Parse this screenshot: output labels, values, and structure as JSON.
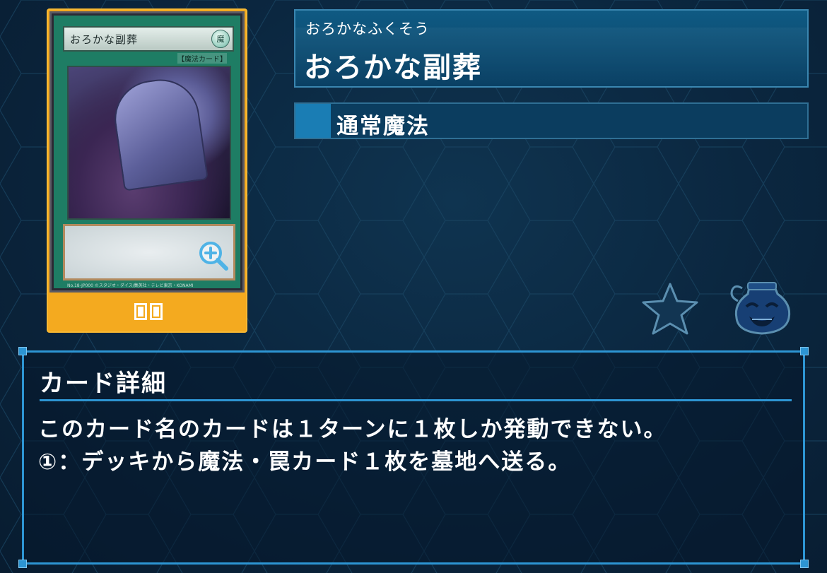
{
  "card": {
    "name_on_card": "おろかな副葬",
    "attribute_glyph": "魔",
    "type_line": "【魔法カード】",
    "footer": "No.18-JP000 ©スタジオ・ダイス/集英社・テレビ東京・KONAMI",
    "bottom_icon": "card-pair-icon"
  },
  "info": {
    "ruby": "おろかなふくそう",
    "title": "おろかな副葬",
    "type": "通常魔法",
    "type_color": "#1a7db4"
  },
  "buttons": {
    "favorite_icon": "star-icon",
    "pot_icon": "pot-of-greed-icon"
  },
  "detail": {
    "heading": "カード詳細",
    "lines": [
      "このカード名のカードは１ターンに１枚しか発動できない。",
      "①：デッキから魔法・罠カード１枚を墓地へ送る。"
    ]
  },
  "colors": {
    "card_frame": "#f4aa1f",
    "panel_accent": "#2d95d3",
    "background": "#0b2740"
  }
}
